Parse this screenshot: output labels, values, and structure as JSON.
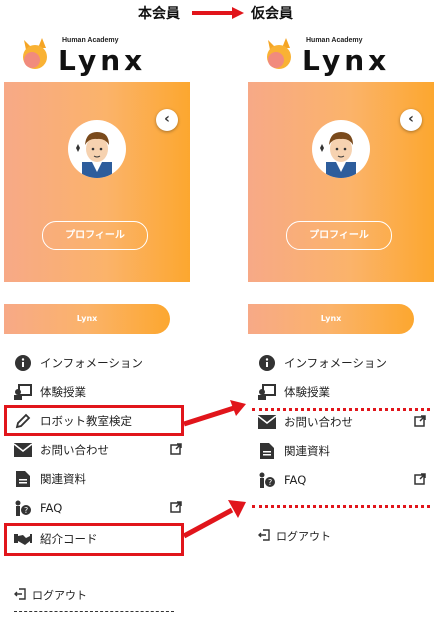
{
  "header": {
    "label_left": "本会員",
    "label_right": "仮会員",
    "arrow_color": "#e1151b"
  },
  "brand": {
    "tagline": "Human Academy",
    "name": "Lynx"
  },
  "profile": {
    "collapse_glyph": "‹",
    "profile_button": "プロフィール",
    "pill_label": "Lynx"
  },
  "left_menu": {
    "items": [
      {
        "label": "インフォメーション",
        "icon": "info-icon",
        "external": false
      },
      {
        "label": "体験授業",
        "icon": "teacher-board-icon",
        "external": false
      },
      {
        "label": "ロボット教室検定",
        "icon": "pencil-icon",
        "external": false
      },
      {
        "label": "お問い合わせ",
        "icon": "envelope-icon",
        "external": true
      },
      {
        "label": "関連資料",
        "icon": "document-icon",
        "external": false
      },
      {
        "label": "FAQ",
        "icon": "person-question-icon",
        "external": true
      },
      {
        "label": "紹介コード",
        "icon": "handshake-icon",
        "external": false
      }
    ],
    "logout": "ログアウト"
  },
  "right_menu": {
    "items": [
      {
        "label": "インフォメーション",
        "icon": "info-icon",
        "external": false
      },
      {
        "label": "体験授業",
        "icon": "teacher-board-icon",
        "external": false
      },
      {
        "label": "お問い合わせ",
        "icon": "envelope-icon",
        "external": true
      },
      {
        "label": "関連資料",
        "icon": "document-icon",
        "external": false
      },
      {
        "label": "FAQ",
        "icon": "person-question-icon",
        "external": true
      }
    ],
    "logout": "ログアウト"
  },
  "colors": {
    "accent_orange": "#fca72f",
    "gradient_start": "#f7a987",
    "highlight_red": "#e1151b"
  }
}
